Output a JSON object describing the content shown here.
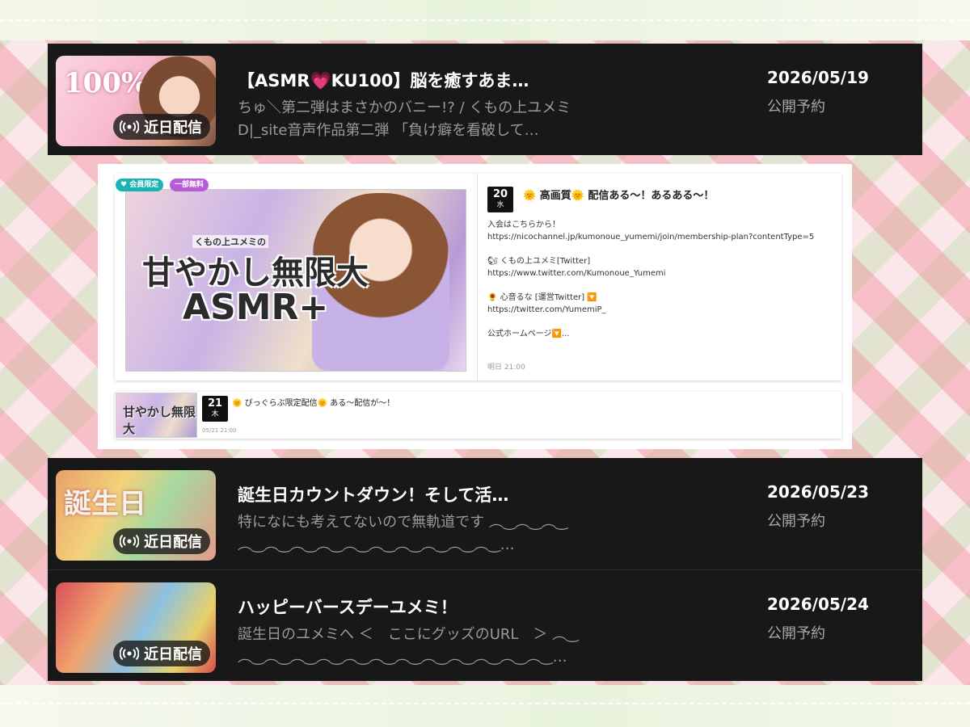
{
  "live_badge_label": "近日配信",
  "dark_rows_top": [
    {
      "title": "【ASMR💗KU100】脳を癒すあま…",
      "description": "ちゅ＼第二弾はまさかのバニー!? / くもの上ユメミD|_site音声作品第二弾 「負け癖を看破して…",
      "date": "2026/05/19",
      "status": "公開予約",
      "thumb_text": "100%"
    }
  ],
  "embedded": {
    "pill_member": "会員限定",
    "pill_free": "一部無料",
    "hero_sub": "くもの上ユメミの",
    "hero_logo_line1": "甘やかし無限大",
    "hero_logo_line2": "ASMR+",
    "main": {
      "day": "20",
      "weekday": "水",
      "title": "🌞 高画質🌞 配信ある〜！あるある〜！",
      "body": "入会はこちらから！\nhttps://nicochannel.jp/kumonoue_yumemi/join/membership-plan?contentType=5\n\n🐿 くもの上ユメミ[Twitter]\nhttps://www.twitter.com/Kumonoue_Yumemi\n\n🌻 心音るな [運営Twitter] 🔽\nhttps://twitter.com/YumemiP_\n\n公式ホームページ🔽...",
      "time": "明日 21:00"
    },
    "sub": {
      "day": "21",
      "weekday": "木",
      "title": "🌞 ぴっぐらぶ限定配信🌞 ある〜配信が〜！",
      "time": "05/21 21:00",
      "thumb_text": "甘やかし無限大"
    }
  },
  "dark_rows_bottom": [
    {
      "title": "誕生日カウントダウン！そして活…",
      "description": "特になにも考えてないので無軌道です ︵‿︵‿︵‿︵‿︵‿︵‿︵‿︵‿︵‿︵‿︵‿︵‿︵‿…",
      "date": "2026/05/23",
      "status": "公開予約",
      "thumb_text": "誕生日"
    },
    {
      "title": "ハッピーバースデーユメミ！",
      "description": "誕生日のユメミへ ＜　ここにグッズのURL　＞ ︵‿︵‿︵‿︵‿︵‿︵‿︵‿︵‿︵‿︵‿︵‿︵‿︵‿…",
      "date": "2026/05/24",
      "status": "公開予約",
      "thumb_text": ""
    }
  ],
  "colors": {
    "dark_panel": "#181818",
    "pill_member": "#19b3b3",
    "pill_free": "#b85bd8",
    "heart": "#ff5fa2"
  }
}
